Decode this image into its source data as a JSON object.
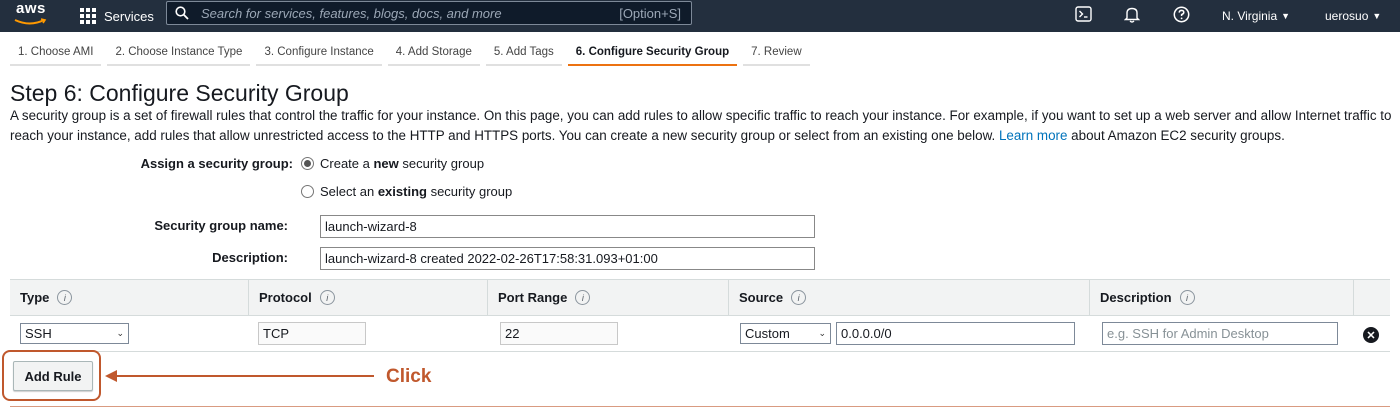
{
  "topnav": {
    "logo_text": "aws",
    "services_label": "Services",
    "search_placeholder": "Search for services, features, blogs, docs, and more",
    "search_shortcut": "[Option+S]",
    "region": "N. Virginia",
    "user": "uerosuo",
    "icons": [
      "terminal-icon",
      "bell-icon",
      "help-icon"
    ]
  },
  "tabs": [
    {
      "label": "1. Choose AMI",
      "active": false
    },
    {
      "label": "2. Choose Instance Type",
      "active": false
    },
    {
      "label": "3. Configure Instance",
      "active": false
    },
    {
      "label": "4. Add Storage",
      "active": false
    },
    {
      "label": "5. Add Tags",
      "active": false
    },
    {
      "label": "6. Configure Security Group",
      "active": true
    },
    {
      "label": "7. Review",
      "active": false
    }
  ],
  "page": {
    "title": "Step 6: Configure Security Group",
    "intro_text": "A security group is a set of firewall rules that control the traffic for your instance. On this page, you can add rules to allow specific traffic to reach your instance. For example, if you want to set up a web server and allow Internet traffic to reach your instance, add rules that allow unrestricted access to the HTTP and HTTPS ports. You can create a new security group or select from an existing one below.",
    "learn_more": "Learn more",
    "intro_tail": "about Amazon EC2 security groups."
  },
  "assign": {
    "label": "Assign a security group:",
    "option_new_pre": "Create a ",
    "option_new_bold": "new",
    "option_new_post": " security group",
    "option_existing_pre": "Select an ",
    "option_existing_bold": "existing",
    "option_existing_post": " security group",
    "selected": "new"
  },
  "form": {
    "name_label": "Security group name:",
    "name_value": "launch-wizard-8",
    "desc_label": "Description:",
    "desc_value": "launch-wizard-8 created 2022-02-26T17:58:31.093+01:00"
  },
  "rules": {
    "columns": [
      "Type",
      "Protocol",
      "Port Range",
      "Source",
      "Description"
    ],
    "rows": [
      {
        "type": "SSH",
        "protocol": "TCP",
        "port_range": "22",
        "source_mode": "Custom",
        "source_value": "0.0.0.0/0",
        "description_placeholder": "e.g. SSH for Admin Desktop"
      }
    ],
    "add_rule_label": "Add Rule"
  },
  "annotation": {
    "text": "Click",
    "color": "#c0582d"
  },
  "colors": {
    "nav_bg": "#232f3e",
    "active_tab": "#ec7211",
    "link": "#0073bb"
  }
}
